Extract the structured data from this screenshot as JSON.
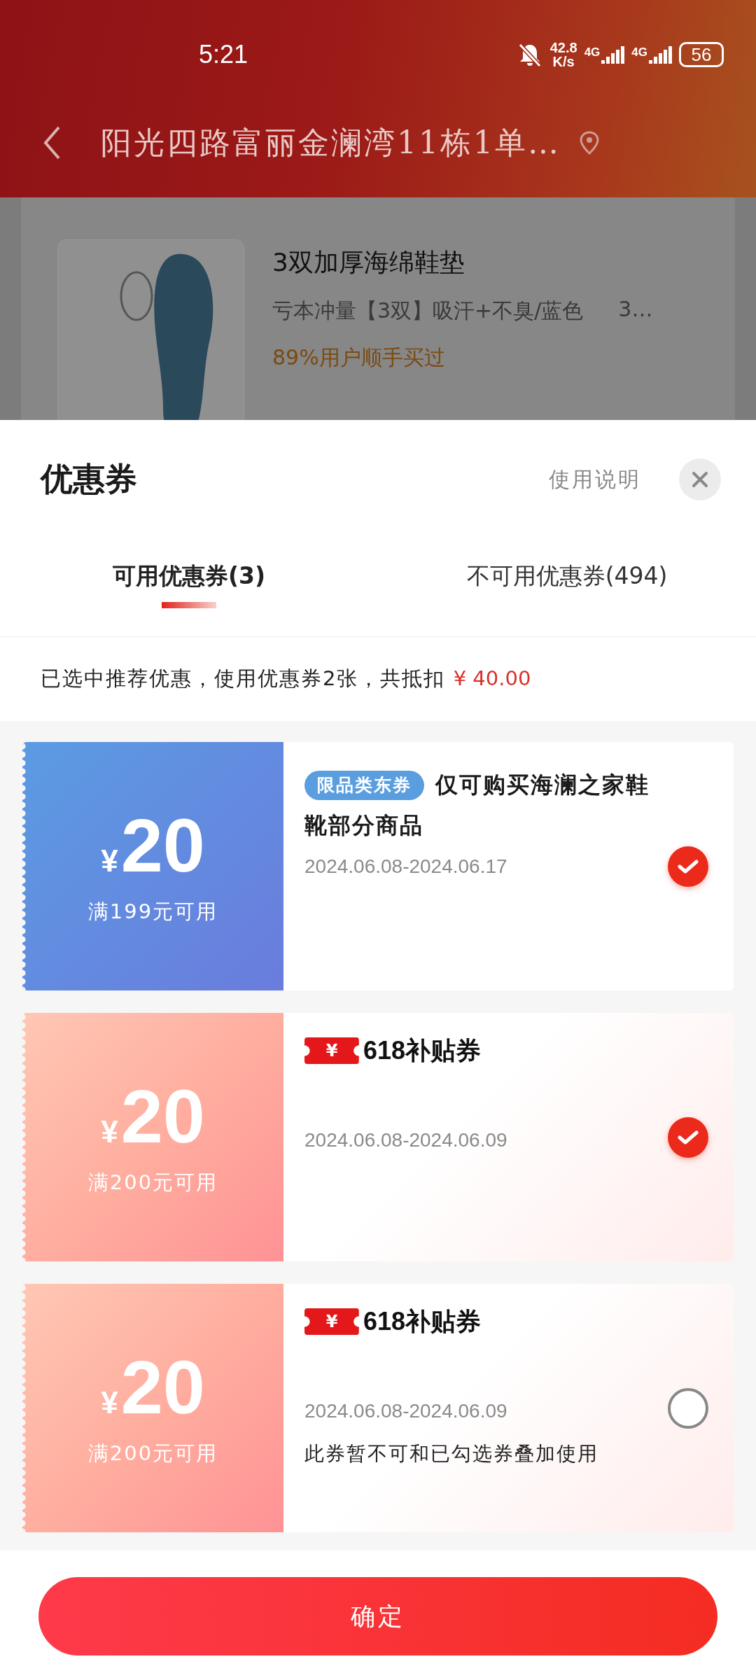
{
  "status_bar": {
    "time": "5:21",
    "net_speed": "42.8",
    "net_unit": "K/s",
    "sim1": "4G",
    "sim2": "4G",
    "battery": "56"
  },
  "nav": {
    "address": "阳光四路富丽金澜湾11栋1单…"
  },
  "background_page": {
    "product": {
      "name": "3双加厚海绵鞋垫",
      "spec": "亏本冲量【3双】吸汗+不臭/蓝色",
      "spec_more": "3…",
      "social": "89%用户顺手买过"
    }
  },
  "sheet": {
    "title": "优惠券",
    "help": "使用说明",
    "tabs": [
      {
        "label": "可用优惠券(3)",
        "selected": true
      },
      {
        "label": "不可用优惠券(494)",
        "selected": false
      }
    ],
    "summary": "已选中推荐优惠，使用优惠券2张，共抵扣",
    "summary_amount": "¥ 40.00",
    "coupons": [
      {
        "kind": "category",
        "currency": "¥",
        "amount": "20",
        "condition": "满199元可用",
        "tag": "限品类东券",
        "title": "仅可购买海澜之家鞋靴部分商品",
        "dates": "2024.06.08-2024.06.17",
        "selected": true
      },
      {
        "kind": "subsidy",
        "currency": "¥",
        "amount": "20",
        "condition": "满200元可用",
        "badge_symbol": "¥",
        "badge_label": "618补贴券",
        "dates": "2024.06.08-2024.06.09",
        "selected": true
      },
      {
        "kind": "subsidy",
        "currency": "¥",
        "amount": "20",
        "condition": "满200元可用",
        "badge_symbol": "¥",
        "badge_label": "618补贴券",
        "dates": "2024.06.08-2024.06.09",
        "note": "此券暂不可和已勾选券叠加使用",
        "selected": false
      }
    ],
    "confirm": "确定"
  }
}
